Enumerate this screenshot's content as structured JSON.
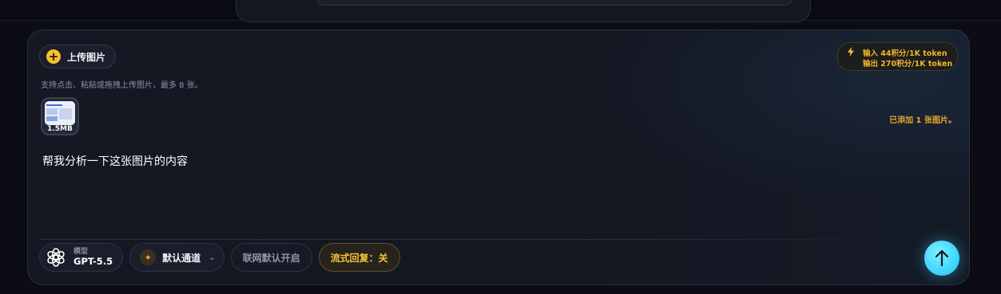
{
  "upload": {
    "label": "上传图片",
    "hint": "支持点击、粘贴或拖拽上传图片，最多 8 张。"
  },
  "pricing": {
    "input_line": "输入 44积分/1K token",
    "output_line": "输出 270积分/1K token"
  },
  "attachment": {
    "size": "1.5MB",
    "added_text": "已添加 1 张图片。"
  },
  "prompt": {
    "text": "帮我分析一下这张图片的内容"
  },
  "toolbar": {
    "model_label": "模型",
    "model_value": "GPT-5.5",
    "channel_label": "默认通道",
    "web_label": "联网默认开启",
    "stream_label": "流式回复：关"
  },
  "send": {
    "icon": "↑"
  },
  "icons": {
    "upload": "plus-icon",
    "pricing": "bolt-icon",
    "model": "openai-icon",
    "channel": "sparkle-icon",
    "dropdown": "chevron-down-icon",
    "send": "arrow-up-icon"
  },
  "colors": {
    "accent_yellow": "#f5c02d",
    "pricing_text": "#f0b52c",
    "send_button": "#3fd6ff",
    "background": "#0b0c14"
  }
}
